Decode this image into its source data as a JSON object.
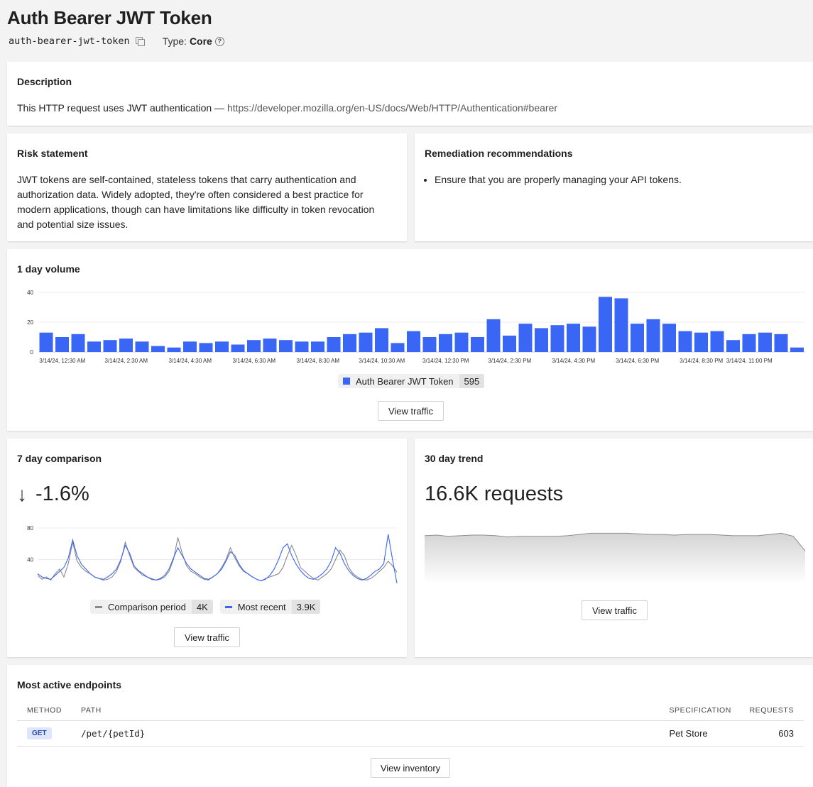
{
  "header": {
    "title": "Auth Bearer JWT Token",
    "slug": "auth-bearer-jwt-token",
    "type_label": "Type:",
    "type_value": "Core",
    "copy_icon": "copy-icon",
    "help_icon": "help-icon"
  },
  "description": {
    "title": "Description",
    "text": "This HTTP request uses JWT authentication — ",
    "link": "https://developer.mozilla.org/en-US/docs/Web/HTTP/Authentication#bearer"
  },
  "risk": {
    "title": "Risk statement",
    "lines": [
      "JWT tokens are self-contained, stateless tokens that carry authentication and",
      "authorization data. Widely adopted, they're often considered a best practice for",
      "modern applications, though can have limitations like difficulty in token revocation",
      "and potential size issues."
    ]
  },
  "remediation": {
    "title": "Remediation recommendations",
    "items": [
      "Ensure that you are properly managing your API tokens."
    ]
  },
  "volume": {
    "title": "1 day volume",
    "legend_label": "Auth Bearer JWT Token",
    "legend_count": "595",
    "button": "View traffic"
  },
  "comparison": {
    "title": "7 day comparison",
    "stat": "-1.6%",
    "arrow_icon": "arrow-down-icon",
    "legend": [
      {
        "label": "Comparison period",
        "count": "4K"
      },
      {
        "label": "Most recent",
        "count": "3.9K"
      }
    ],
    "button": "View traffic"
  },
  "trend": {
    "title": "30 day trend",
    "stat": "16.6K requests",
    "button": "View traffic"
  },
  "endpoints": {
    "title": "Most active endpoints",
    "columns": [
      "METHOD",
      "PATH",
      "SPECIFICATION",
      "REQUESTS"
    ],
    "rows": [
      {
        "method": "GET",
        "path": "/pet/{petId}",
        "spec": "Pet Store",
        "requests": "603"
      }
    ],
    "button": "View inventory"
  },
  "colors": {
    "blue": "#3a66f5",
    "gray": "#8a8a8a",
    "area_top": "#d8d8d8"
  },
  "chart_data": [
    {
      "type": "bar",
      "title": "1 day volume",
      "ylim": [
        0,
        40
      ],
      "yticks": [
        0,
        20,
        40
      ],
      "xtick_labels": [
        "3/14/24, 12:30 AM",
        "3/14/24, 2:30 AM",
        "3/14/24, 4:30 AM",
        "3/14/24, 6:30 AM",
        "3/14/24, 8:30 AM",
        "3/14/24, 10:30 AM",
        "3/14/24, 12:30 PM",
        "3/14/24, 2:30 PM",
        "3/14/24, 4:30 PM",
        "3/14/24, 6:30 PM",
        "3/14/24, 8:30 PM",
        "3/14/24, 11:00 PM"
      ],
      "series": [
        {
          "name": "Auth Bearer JWT Token",
          "values": [
            13,
            10,
            12,
            7,
            8,
            9,
            7,
            4,
            3,
            7,
            6,
            7,
            5,
            8,
            9,
            8,
            7,
            7,
            10,
            12,
            13,
            16,
            6,
            14,
            10,
            12,
            13,
            10,
            22,
            11,
            19,
            16,
            18,
            19,
            17,
            37,
            36,
            19,
            22,
            19,
            14,
            13,
            14,
            8,
            12,
            13,
            12,
            3
          ]
        }
      ],
      "grid": true
    },
    {
      "type": "line",
      "title": "7 day comparison",
      "ylim": [
        0,
        80
      ],
      "yticks": [
        40,
        80
      ],
      "series": [
        {
          "name": "Comparison period",
          "values": [
            20,
            15,
            18,
            14,
            22,
            28,
            18,
            35,
            62,
            38,
            30,
            25,
            22,
            18,
            16,
            14,
            15,
            18,
            25,
            38,
            62,
            45,
            30,
            25,
            20,
            18,
            16,
            14,
            15,
            18,
            25,
            40,
            68,
            48,
            32,
            25,
            22,
            18,
            15,
            14,
            18,
            22,
            30,
            40,
            55,
            42,
            32,
            25,
            22,
            18,
            15,
            13,
            16,
            18,
            20,
            22,
            30,
            45,
            58,
            45,
            30,
            25,
            20,
            16,
            14,
            18,
            22,
            28,
            40,
            52,
            45,
            30,
            22,
            18,
            15,
            14,
            16,
            20,
            25,
            30,
            38,
            32,
            24
          ]
        },
        {
          "name": "Most recent",
          "values": [
            22,
            18,
            16,
            15,
            20,
            25,
            30,
            42,
            65,
            45,
            34,
            28,
            22,
            18,
            16,
            15,
            18,
            22,
            28,
            40,
            58,
            48,
            32,
            26,
            22,
            18,
            15,
            14,
            16,
            20,
            28,
            42,
            55,
            45,
            35,
            28,
            24,
            20,
            16,
            15,
            18,
            22,
            28,
            38,
            50,
            45,
            34,
            26,
            22,
            18,
            15,
            13,
            15,
            20,
            28,
            40,
            55,
            60,
            45,
            34,
            26,
            20,
            16,
            15,
            18,
            22,
            28,
            38,
            55,
            48,
            35,
            26,
            20,
            16,
            14,
            16,
            20,
            25,
            28,
            35,
            72,
            40,
            10
          ]
        }
      ]
    },
    {
      "type": "area",
      "title": "30 day trend",
      "values": [
        555,
        556,
        554,
        555,
        556,
        556,
        555,
        553,
        554,
        554,
        554,
        554,
        555,
        557,
        559,
        559,
        559,
        559,
        558,
        557,
        557,
        556,
        557,
        557,
        557,
        556,
        555,
        555,
        555,
        557,
        559,
        554,
        530
      ]
    }
  ]
}
